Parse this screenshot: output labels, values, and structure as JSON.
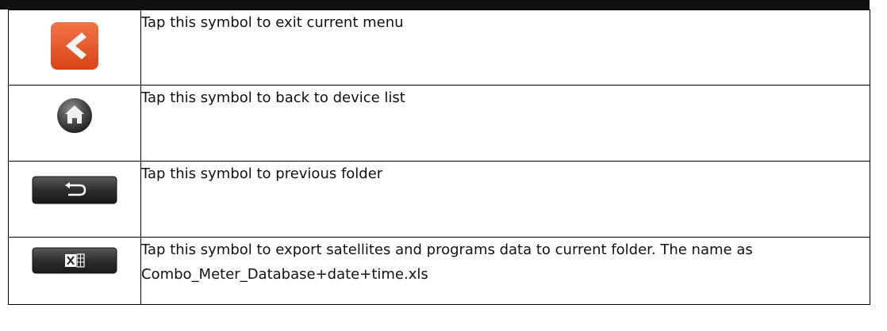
{
  "rows": [
    {
      "icon": "exit-arrow-icon",
      "text": "Tap this symbol to exit current menu"
    },
    {
      "icon": "home-icon",
      "text": "Tap this symbol to back to device list"
    },
    {
      "icon": "return-folder-icon",
      "text": "Tap this symbol to previous folder"
    },
    {
      "icon": "excel-export-icon",
      "text": "Tap this symbol to export satellites and programs data to current folder. The name as Combo_Meter_Database+date+time.xls"
    }
  ],
  "colors": {
    "exit_orange": "#e8552a",
    "dark_button": "#3a3a3a",
    "border": "#000000"
  }
}
